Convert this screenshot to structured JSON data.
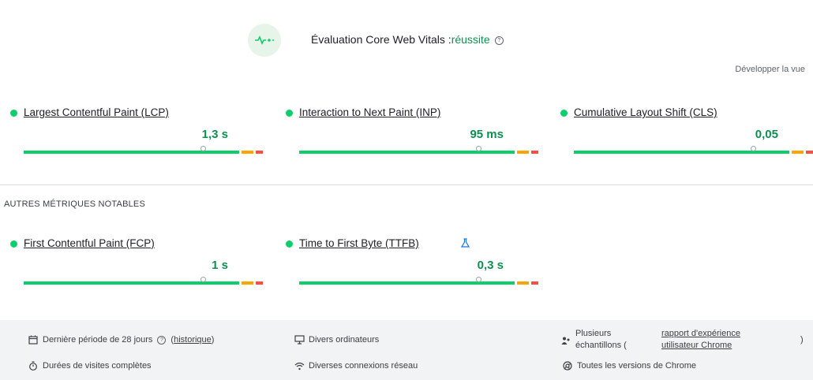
{
  "header": {
    "title": "Évaluation Core Web Vitals :",
    "status": "réussite",
    "help": "?",
    "expand_view": "Développer la vue"
  },
  "core_metrics": [
    {
      "name": "Largest Contentful Paint (LCP)",
      "value": "1,3 s",
      "rating": "good"
    },
    {
      "name": "Interaction to Next Paint (INP)",
      "value": "95 ms",
      "rating": "good"
    },
    {
      "name": "Cumulative Layout Shift (CLS)",
      "value": "0,05",
      "rating": "good"
    }
  ],
  "other_section_title": "AUTRES MÉTRIQUES NOTABLES",
  "other_metrics": [
    {
      "name": "First Contentful Paint (FCP)",
      "value": "1 s",
      "rating": "good"
    },
    {
      "name": "Time to First Byte (TTFB)",
      "value": "0,3 s",
      "rating": "good",
      "experimental_icon": "flask-icon"
    }
  ],
  "footer": {
    "period": "Dernière période de 28 jours",
    "period_help": "?",
    "history_open": "(",
    "history": "historique",
    "history_close": ")",
    "visit_durations": "Durées de visites complètes",
    "devices": "Divers ordinateurs",
    "connections": "Diverses connexions réseau",
    "samples_line1": "Plusieurs",
    "samples_line2": "échantillons (",
    "report_line1": "rapport d'expérience",
    "report_line2": "utilisateur Chrome",
    "report_close": ")",
    "chrome_versions": "Toutes les versions de Chrome"
  },
  "colors": {
    "good": "#0cce6b",
    "good_text": "#0d904f",
    "needs_improvement": "#ffa400",
    "poor": "#ff4e42"
  }
}
